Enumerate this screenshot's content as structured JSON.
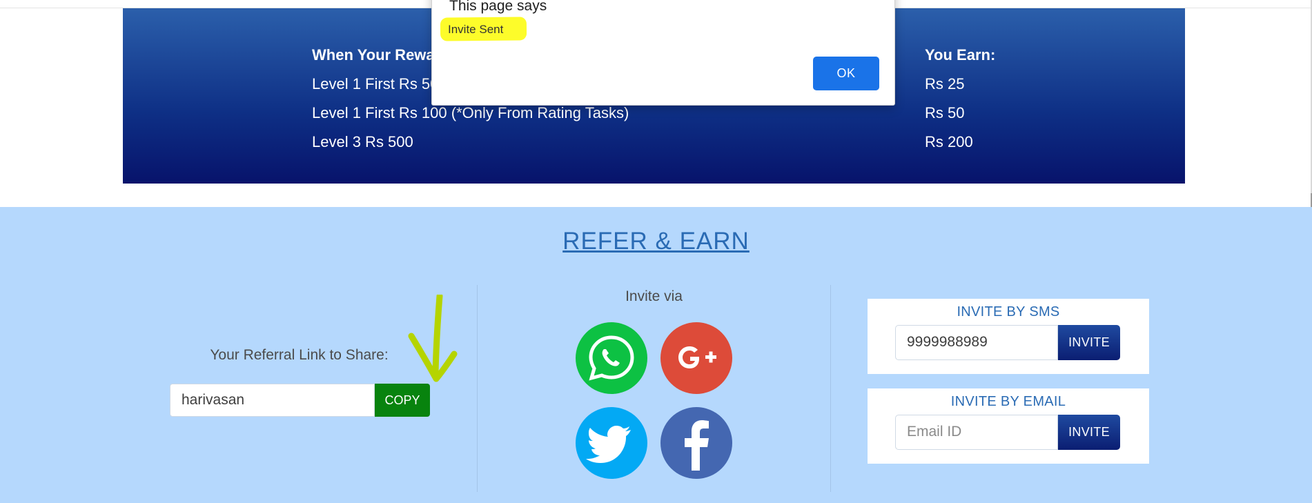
{
  "rewards": {
    "col1_header": "When Your Rewa",
    "col2_header": "You Earn:",
    "rows": [
      {
        "condition": "Level 1 First Rs 50",
        "earn": "Rs 25"
      },
      {
        "condition": "Level 1 First Rs 100 (*Only From Rating Tasks)",
        "earn": "Rs 50"
      },
      {
        "condition": "Level 3 Rs 500",
        "earn": "Rs 200"
      }
    ]
  },
  "refer": {
    "title": "REFER & EARN",
    "referral_label": "Your Referral Link to Share:",
    "referral_value": "harivasan",
    "copy_label": "COPY",
    "invite_via": "Invite via",
    "social": [
      {
        "name": "whatsapp-icon",
        "color": "#0dc143"
      },
      {
        "name": "google-plus-icon",
        "color": "#dd4b39"
      },
      {
        "name": "twitter-icon",
        "color": "#03a9f4"
      },
      {
        "name": "facebook-icon",
        "color": "#3b5998"
      }
    ],
    "sms": {
      "title": "INVITE BY SMS",
      "value": "9999988989",
      "button": "INVITE"
    },
    "email": {
      "title": "INVITE BY EMAIL",
      "placeholder": "Email ID",
      "button": "INVITE"
    }
  },
  "dialog": {
    "heading": "This page says",
    "message": "Invite Sent",
    "ok_label": "OK"
  },
  "colors": {
    "banner_top": "#2b5fab",
    "banner_bottom": "#07136b",
    "refer_bg": "#b5d8fd",
    "copy_green": "#08830e",
    "highlight": "#fdfc2a",
    "annotation_arrow": "#b5d400"
  }
}
